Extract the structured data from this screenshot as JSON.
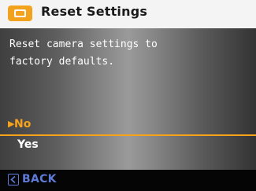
{
  "header": {
    "title": "Reset Settings",
    "icon": "settings-tab-icon",
    "icon_color": "#f2a21c"
  },
  "dialog": {
    "message": "Reset camera settings to\nfactory defaults."
  },
  "options": {
    "no": {
      "label": "No",
      "selected": true,
      "marker": "▶"
    },
    "yes": {
      "label": "Yes",
      "selected": false
    }
  },
  "footer": {
    "back_label": "BACK",
    "back_icon": "back-key-icon",
    "accent_color": "#5e7ad8"
  },
  "colors": {
    "highlight": "#f7a21b"
  }
}
